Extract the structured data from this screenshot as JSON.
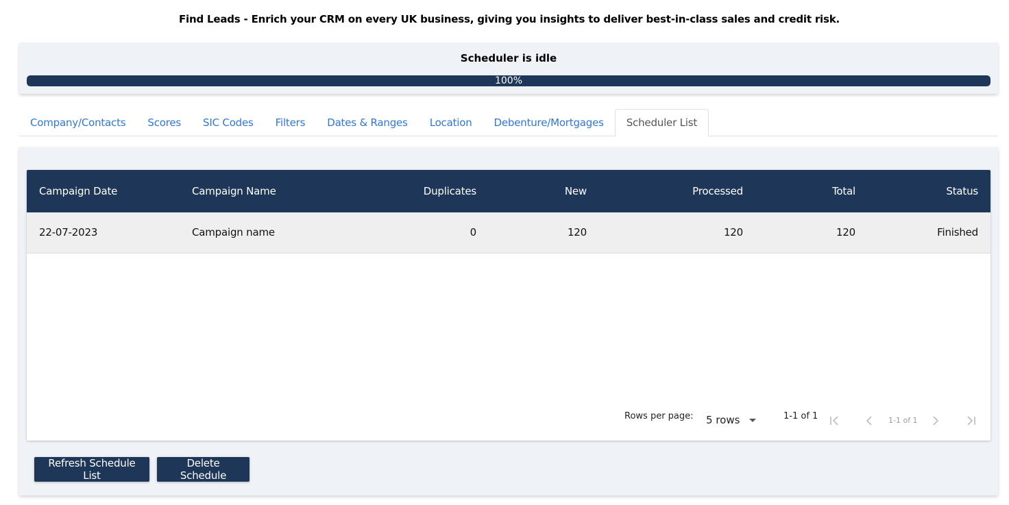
{
  "header": {
    "title": "Find Leads - Enrich your CRM on every UK business, giving you insights to deliver best-in-class sales and credit risk."
  },
  "scheduler": {
    "status": "Scheduler is idle",
    "progress_label": "100%",
    "progress": 100
  },
  "tabs": [
    {
      "label": "Company/Contacts",
      "active": false
    },
    {
      "label": "Scores",
      "active": false
    },
    {
      "label": "SIC Codes",
      "active": false
    },
    {
      "label": "Filters",
      "active": false
    },
    {
      "label": "Dates & Ranges",
      "active": false
    },
    {
      "label": "Location",
      "active": false
    },
    {
      "label": "Debenture/Mortgages",
      "active": false
    },
    {
      "label": "Scheduler List",
      "active": true
    }
  ],
  "table": {
    "columns": [
      "Campaign Date",
      "Campaign Name",
      "Duplicates",
      "New",
      "Processed",
      "Total",
      "Status"
    ],
    "rows": [
      [
        "22-07-2023",
        "Campaign name",
        "0",
        "120",
        "120",
        "120",
        "Finished"
      ]
    ]
  },
  "pagination": {
    "rows_per_page_label": "Rows per page:",
    "rows_select": "5 rows",
    "range": "1-1 of 1",
    "range_small": "1-1 of 1"
  },
  "actions": {
    "refresh_label": "Refresh Schedule List",
    "delete_label": "Delete Schedule"
  },
  "colors": {
    "navy": "#1e3658",
    "tab_link": "#2f78d9",
    "panel_bg": "#eff2f6"
  }
}
